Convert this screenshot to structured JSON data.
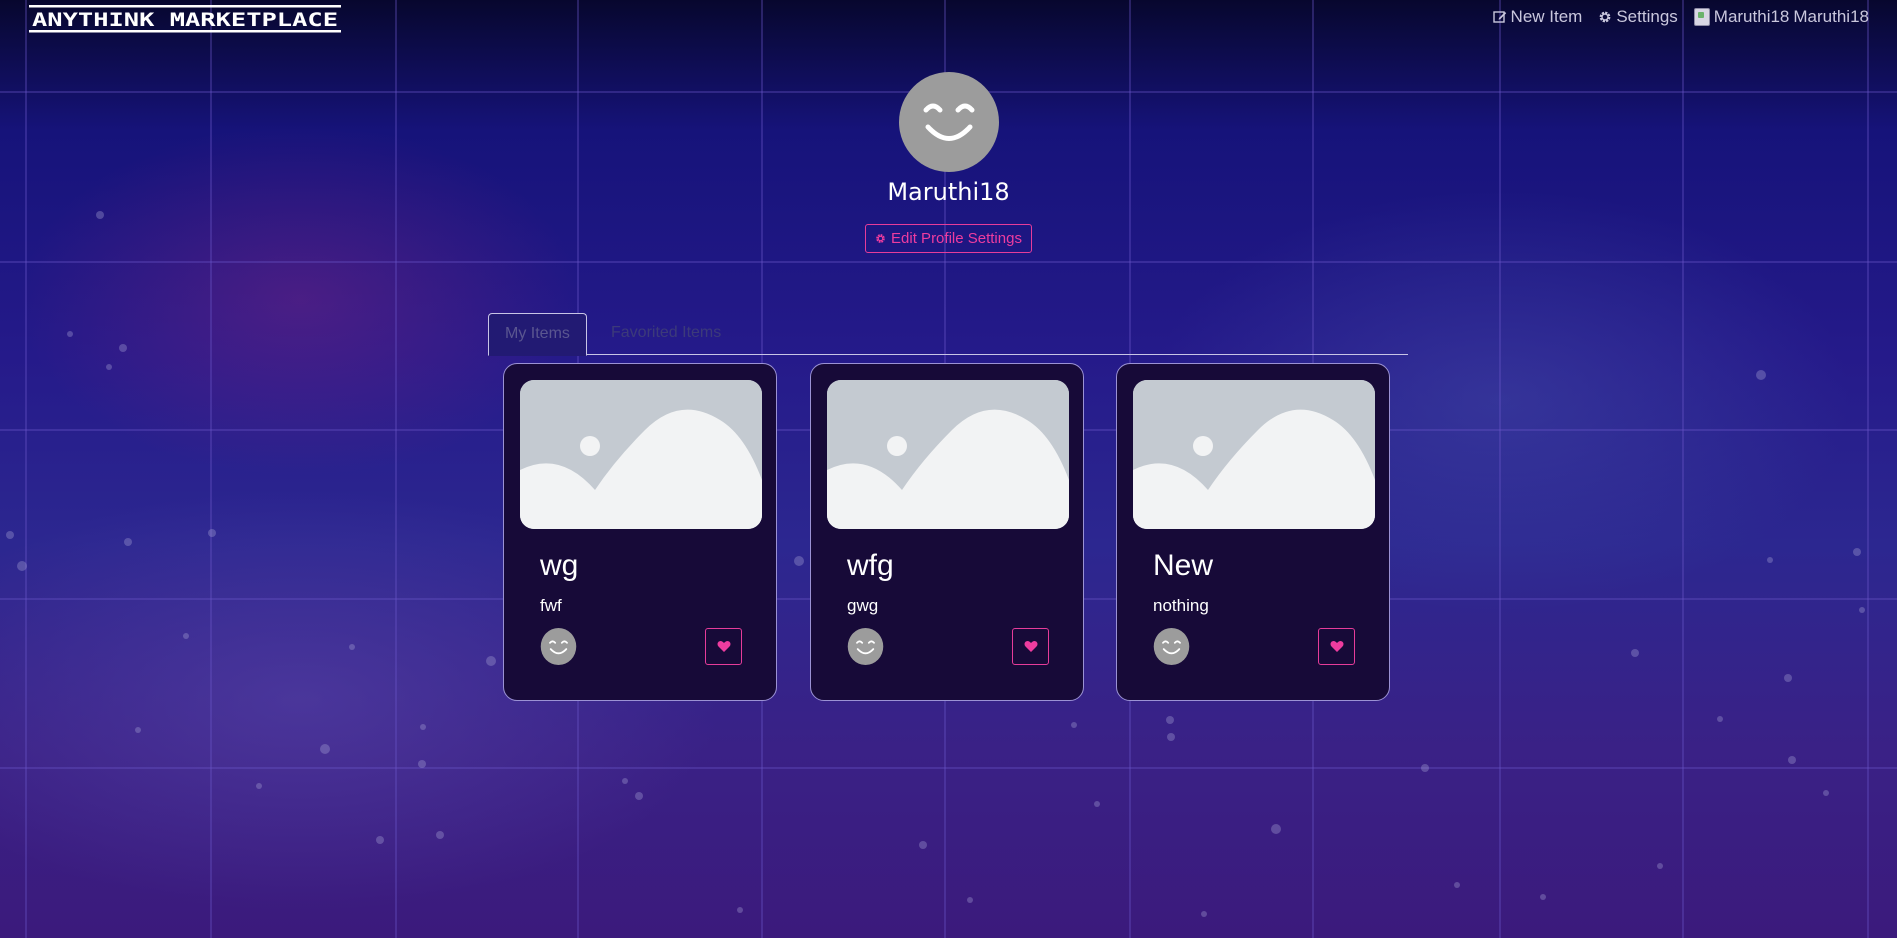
{
  "header": {
    "logo_text": "ANYTHINK MARKETPLACE",
    "nav": {
      "new_item": "New Item",
      "settings": "Settings",
      "user_alt": "Maruthi18",
      "username": "Maruthi18"
    }
  },
  "profile": {
    "username": "Maruthi18",
    "edit_button": "Edit Profile Settings"
  },
  "tabs": [
    {
      "label": "My Items",
      "active": true
    },
    {
      "label": "Favorited Items",
      "active": false
    }
  ],
  "items": [
    {
      "title": "wg",
      "description": "fwf"
    },
    {
      "title": "wfg",
      "description": "gwg"
    },
    {
      "title": "New",
      "description": "nothing"
    }
  ],
  "colors": {
    "accent": "#e63c9a",
    "card_bg": "#170a38",
    "avatar_gray": "#9c9c9c"
  },
  "icons": {
    "new_item": "edit-icon",
    "settings": "gear-icon",
    "favorite": "heart-icon",
    "avatar": "smiley-avatar",
    "placeholder": "image-placeholder-icon"
  }
}
